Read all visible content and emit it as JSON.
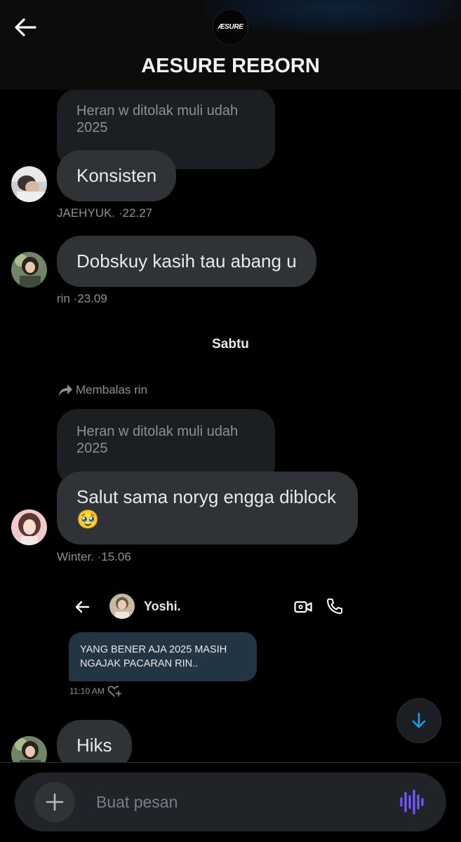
{
  "header": {
    "title": "AESURE REBORN",
    "logo_text": "ÆSURE",
    "back_icon": "arrow-left-icon"
  },
  "messages": [
    {
      "quoted": "Heran w ditolak muli udah 2025",
      "text": "Konsisten",
      "sender": "JAEHYUK.",
      "time": "·22.27"
    },
    {
      "text": "Dobskuy kasih tau abang u",
      "sender": "rin",
      "time": "·23.09"
    },
    {
      "reply_indicator": "Membalas rin",
      "quoted": "Heran w ditolak muli udah 2025",
      "text": "Salut sama noryg engga diblock",
      "emoji": "🥹",
      "sender": "Winter.",
      "time": "·15.06"
    },
    {
      "text": "Hiks"
    }
  ],
  "day_separator": "Sabtu",
  "screenshot": {
    "name": "Yoshi.",
    "message": "YANG BENER AJA 2025 MASIH NGAJAK PACARAN RIN..",
    "time": "11:10 AM"
  },
  "composer": {
    "placeholder": "Buat pesan"
  },
  "colors": {
    "background": "#000000",
    "bubble": "#2f3336",
    "quoted_bubble": "#1c1f22",
    "accent": "#1d9bf0",
    "voice": "#7856ff"
  }
}
